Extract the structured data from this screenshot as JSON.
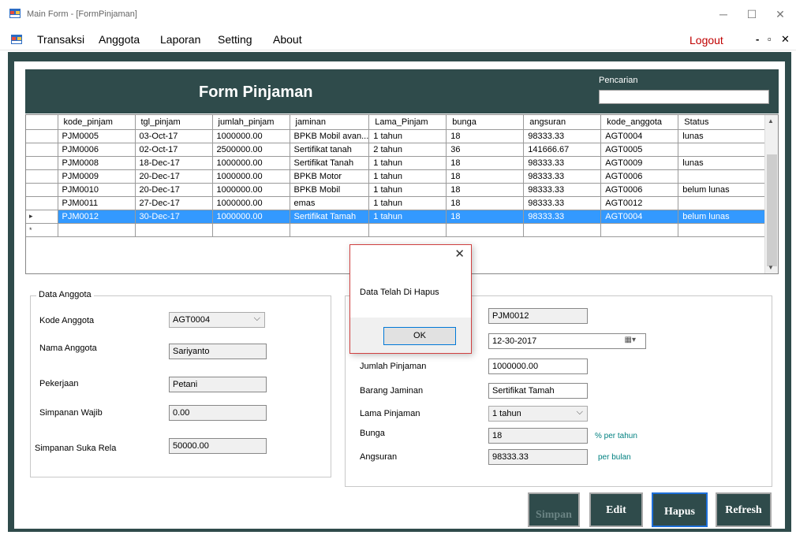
{
  "window": {
    "title": "Main Form - [FormPinjaman]"
  },
  "menu": {
    "items": [
      "Transaksi",
      "Anggota",
      "Laporan",
      "Setting",
      "About"
    ],
    "logout": "Logout"
  },
  "header": {
    "title": "Form Pinjaman",
    "search_label": "Pencarian",
    "search_value": ""
  },
  "grid": {
    "columns": [
      "kode_pinjam",
      "tgl_pinjam",
      "jumlah_pinjam",
      "jaminan",
      "Lama_Pinjam",
      "bunga",
      "angsuran",
      "kode_anggota",
      "Status"
    ],
    "rows": [
      [
        "PJM0005",
        "03-Oct-17",
        "1000000.00",
        "BPKB Mobil avan...",
        "1 tahun",
        "18",
        "98333.33",
        "AGT0004",
        "lunas"
      ],
      [
        "PJM0006",
        "02-Oct-17",
        "2500000.00",
        "Sertifikat tanah",
        "2 tahun",
        "36",
        "141666.67",
        "AGT0005",
        ""
      ],
      [
        "PJM0008",
        "18-Dec-17",
        "1000000.00",
        "Sertifikat Tanah",
        "1 tahun",
        "18",
        "98333.33",
        "AGT0009",
        "lunas"
      ],
      [
        "PJM0009",
        "20-Dec-17",
        "1000000.00",
        "BPKB Motor",
        "1 tahun",
        "18",
        "98333.33",
        "AGT0006",
        ""
      ],
      [
        "PJM0010",
        "20-Dec-17",
        "1000000.00",
        "BPKB Mobil",
        "1 tahun",
        "18",
        "98333.33",
        "AGT0006",
        "belum lunas"
      ],
      [
        "PJM0011",
        "27-Dec-17",
        "1000000.00",
        "emas",
        "1 tahun",
        "18",
        "98333.33",
        "AGT0012",
        ""
      ],
      [
        "PJM0012",
        "30-Dec-17",
        "1000000.00",
        "Sertifikat Tamah",
        "1 tahun",
        "18",
        "98333.33",
        "AGT0004",
        "belum lunas"
      ]
    ],
    "new_row_marker": "*",
    "current_row_marker": "▸"
  },
  "anggota": {
    "group_title": "Data Anggota",
    "kode_label": "Kode Anggota",
    "kode_value": "AGT0004",
    "nama_label": "Nama Anggota",
    "nama_value": "Sariyanto",
    "pekerjaan_label": "Pekerjaan",
    "pekerjaan_value": "Petani",
    "wajib_label": "Simpanan Wajib",
    "wajib_value": "0.00",
    "sukarela_label": "Simpanan Suka Rela",
    "sukarela_value": "50000.00"
  },
  "pinjaman": {
    "kode_value": "PJM0012",
    "tgl_value": "12-30-2017",
    "jumlah_label": "Jumlah Pinjaman",
    "jumlah_value": "1000000.00",
    "jaminan_label": "Barang Jaminan",
    "jaminan_value": "Sertifikat Tamah",
    "lama_label": "Lama Pinjaman",
    "lama_value": "1 tahun",
    "bunga_label": "Bunga",
    "bunga_value": "18",
    "bunga_unit": "% per tahun",
    "angsuran_label": "Angsuran",
    "angsuran_value": "98333.33",
    "angsuran_unit": "per bulan"
  },
  "buttons": {
    "simpan": "Simpan",
    "edit": "Edit",
    "hapus": "Hapus",
    "refresh": "Refresh"
  },
  "dialog": {
    "message": "Data Telah Di Hapus",
    "ok": "OK"
  },
  "colors": {
    "frame": "#2f4b4b",
    "selection": "#3399ff",
    "logout": "#c00000",
    "unit": "#008080"
  }
}
